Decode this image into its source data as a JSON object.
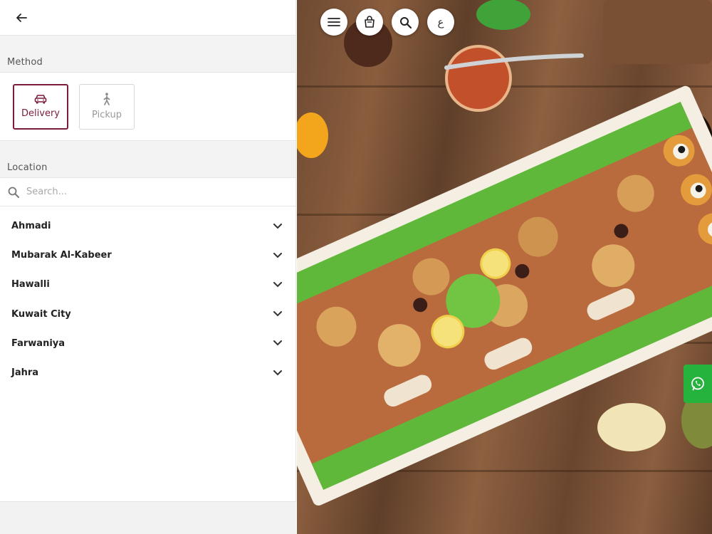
{
  "header": {
    "back_icon": "arrow-left-icon"
  },
  "method": {
    "title": "Method",
    "options": [
      {
        "label": "Delivery",
        "icon": "car-icon",
        "selected": true
      },
      {
        "label": "Pickup",
        "icon": "walking-person-icon",
        "selected": false
      }
    ]
  },
  "location": {
    "title": "Location",
    "search": {
      "placeholder": "Search...",
      "value": ""
    },
    "areas": [
      {
        "name": "Ahmadi"
      },
      {
        "name": "Mubarak Al-Kabeer"
      },
      {
        "name": "Hawalli"
      },
      {
        "name": "Kuwait City"
      },
      {
        "name": "Farwaniya"
      },
      {
        "name": "Jahra"
      }
    ]
  },
  "top_actions": {
    "menu_icon": "hamburger-menu-icon",
    "bag_icon": "shopping-bag-icon",
    "search_icon": "search-icon",
    "language_label": "ع"
  },
  "whatsapp": {
    "icon": "whatsapp-icon"
  },
  "colors": {
    "accent": "#7b1c3a",
    "whatsapp": "#25b23d",
    "inactive": "#9a9a9a"
  }
}
